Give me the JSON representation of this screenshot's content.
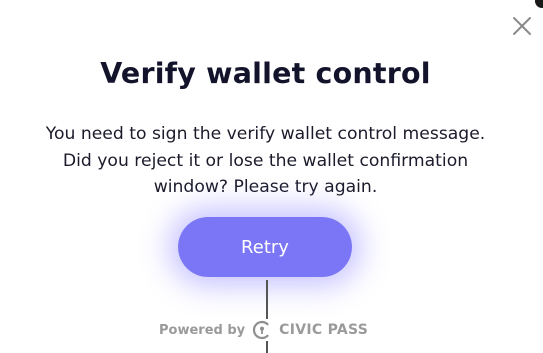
{
  "dialog": {
    "title": "Verify wallet control",
    "message": "You need to sign the verify wallet control message. Did you reject it or lose the wallet confirmation window? Please try again.",
    "retry_label": "Retry",
    "close_icon": "close-icon"
  },
  "footer": {
    "powered_by": "Powered by",
    "brand": "CIVIC PASS",
    "logo_icon": "civic-logo-icon"
  },
  "colors": {
    "accent": "#7b76f6",
    "title": "#13132b",
    "footer_text": "#9a9a9a"
  }
}
